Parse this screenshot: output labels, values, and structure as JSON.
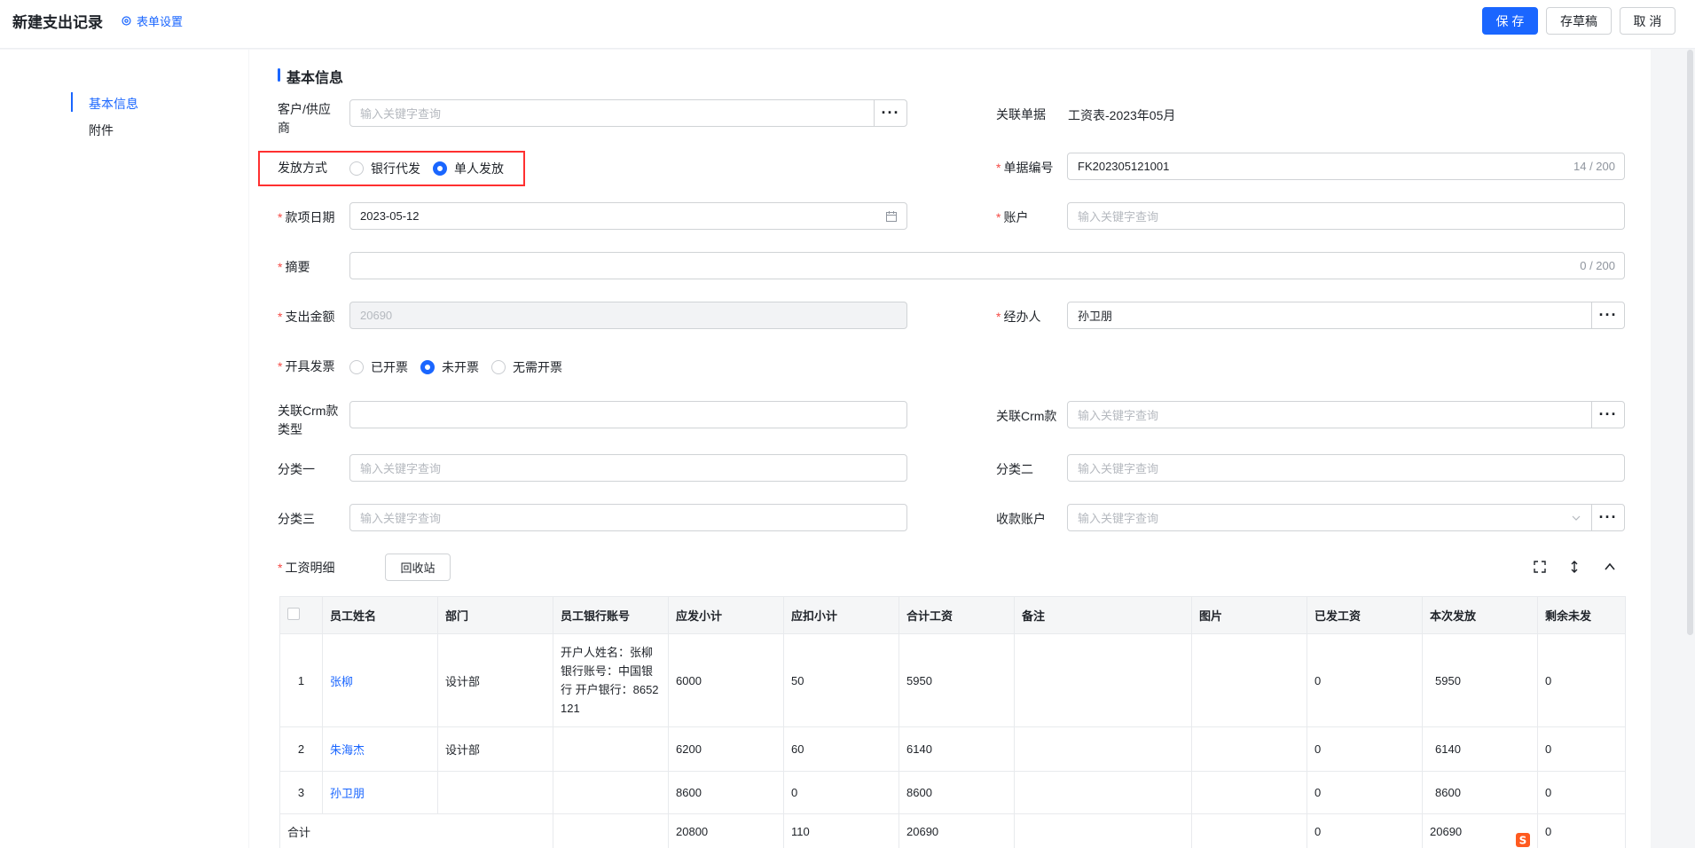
{
  "header": {
    "title": "新建支出记录",
    "settings_label": "表单设置",
    "save_label": "保 存",
    "draft_label": "存草稿",
    "cancel_label": "取 消"
  },
  "sidebar": {
    "items": [
      {
        "label": "基本信息",
        "active": true
      },
      {
        "label": "附件",
        "active": false
      }
    ]
  },
  "form": {
    "section_title": "基本信息",
    "customer": {
      "label": "客户/供应商",
      "placeholder": "输入关键字查询"
    },
    "related_doc": {
      "label": "关联单据",
      "value": "工资表-2023年05月"
    },
    "payment_method": {
      "label": "发放方式",
      "options": [
        {
          "label": "银行代发",
          "selected": false
        },
        {
          "label": "单人发放",
          "selected": true
        }
      ]
    },
    "doc_number": {
      "label": "单据编号",
      "value": "FK202305121001",
      "count": "14 / 200"
    },
    "date": {
      "label": "款项日期",
      "value": "2023-05-12"
    },
    "account": {
      "label": "账户",
      "placeholder": "输入关键字查询"
    },
    "summary": {
      "label": "摘要",
      "value": "",
      "count": "0 / 200"
    },
    "amount": {
      "label": "支出金额",
      "value": "20690"
    },
    "handler": {
      "label": "经办人",
      "value": "孙卫朋"
    },
    "invoice": {
      "label": "开具发票",
      "options": [
        {
          "label": "已开票",
          "selected": false
        },
        {
          "label": "未开票",
          "selected": true
        },
        {
          "label": "无需开票",
          "selected": false
        }
      ]
    },
    "crm_type": {
      "label": "关联Crm款类型",
      "value": ""
    },
    "crm_payment": {
      "label": "关联Crm款",
      "placeholder": "输入关键字查询"
    },
    "category1": {
      "label": "分类一",
      "placeholder": "输入关键字查询"
    },
    "category2": {
      "label": "分类二",
      "placeholder": "输入关键字查询"
    },
    "category3": {
      "label": "分类三",
      "placeholder": "输入关键字查询"
    },
    "receive_account": {
      "label": "收款账户",
      "placeholder": "输入关键字查询"
    }
  },
  "salary": {
    "label": "工资明细",
    "recycle_label": "回收站",
    "columns": [
      "员工姓名",
      "部门",
      "员工银行账号",
      "应发小计",
      "应扣小计",
      "合计工资",
      "备注",
      "图片",
      "已发工资",
      "本次发放",
      "剩余未发"
    ],
    "rows": [
      {
        "no": "1",
        "name": "张柳",
        "dept": "设计部",
        "bank": "开户人姓名：张柳 银行账号：中国银行 开户银行：8652121",
        "gross": "6000",
        "deduct": "50",
        "total": "5950",
        "note": "",
        "image": "",
        "paid": "0",
        "current": "5950",
        "remain": "0"
      },
      {
        "no": "2",
        "name": "朱海杰",
        "dept": "设计部",
        "bank": "",
        "gross": "6200",
        "deduct": "60",
        "total": "6140",
        "note": "",
        "image": "",
        "paid": "0",
        "current": "6140",
        "remain": "0"
      },
      {
        "no": "3",
        "name": "孙卫朋",
        "dept": "",
        "bank": "",
        "gross": "8600",
        "deduct": "0",
        "total": "8600",
        "note": "",
        "image": "",
        "paid": "0",
        "current": "8600",
        "remain": "0"
      }
    ],
    "totals": {
      "label": "合计",
      "gross": "20800",
      "deduct": "110",
      "total": "20690",
      "paid": "0",
      "current": "20690",
      "remain": "0"
    }
  },
  "colors": {
    "primary": "#1a66ff",
    "required": "#f54a45",
    "highlight": "#ff3030"
  }
}
